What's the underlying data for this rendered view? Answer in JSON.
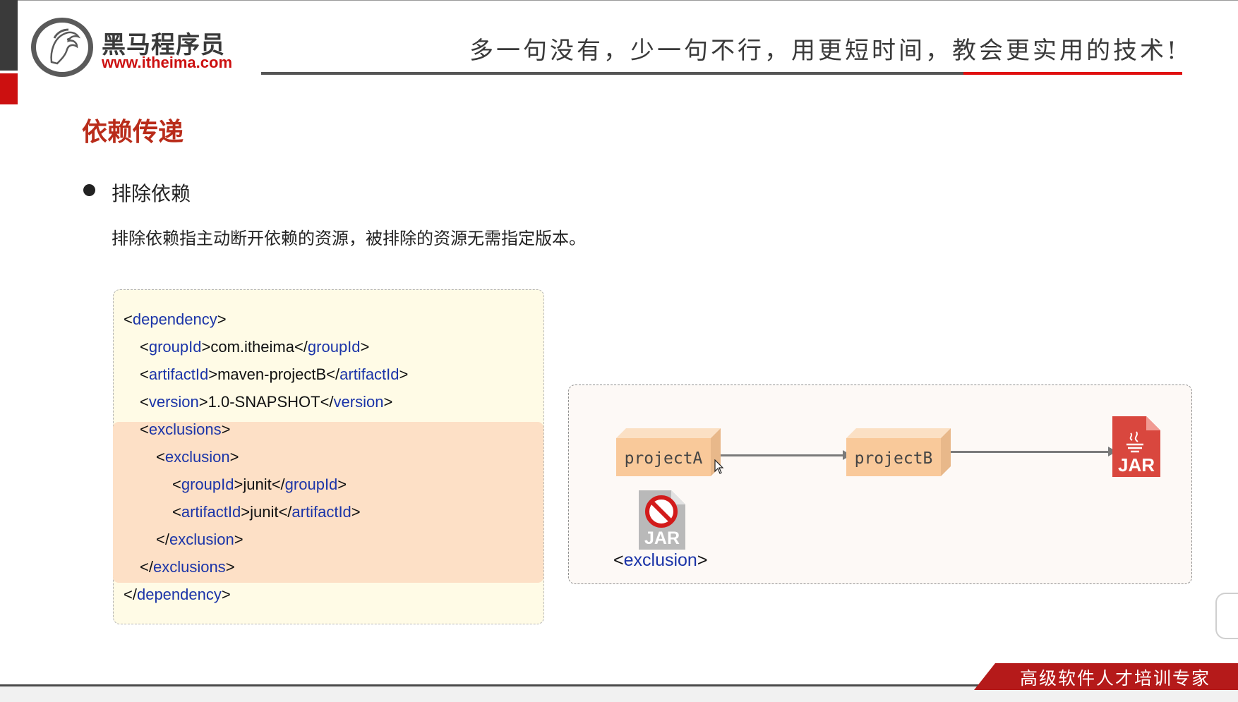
{
  "header": {
    "logo_name": "黑马程序员",
    "logo_url": "www.itheima.com",
    "slogan": "多一句没有，少一句不行，用更短时间，教会更实用的技术!"
  },
  "title": "依赖传递",
  "bullet": "排除依赖",
  "description": "排除依赖指主动断开依赖的资源，被排除的资源无需指定版本。",
  "code": {
    "dependency": "dependency",
    "groupId": "groupId",
    "artifactId": "artifactId",
    "version": "version",
    "exclusions": "exclusions",
    "exclusion": "exclusion",
    "group_value": "com.itheima",
    "artifact_value": "maven-projectB",
    "version_value": "1.0-SNAPSHOT",
    "excl_group_value": "junit",
    "excl_artifact_value": "junit"
  },
  "diagram": {
    "project_a": "projectA",
    "project_b": "projectB",
    "jar_label": "JAR",
    "excluded_jar_label": "JAR",
    "exclusion_tag": "exclusion"
  },
  "footer": {
    "text": "高级软件人才培训专家"
  },
  "colors": {
    "accent_red": "#cc1010",
    "title_red": "#b92c1a",
    "xml_tag_blue": "#1b34a8",
    "highlight": "#fde0c6",
    "code_bg": "#fffbe6"
  }
}
